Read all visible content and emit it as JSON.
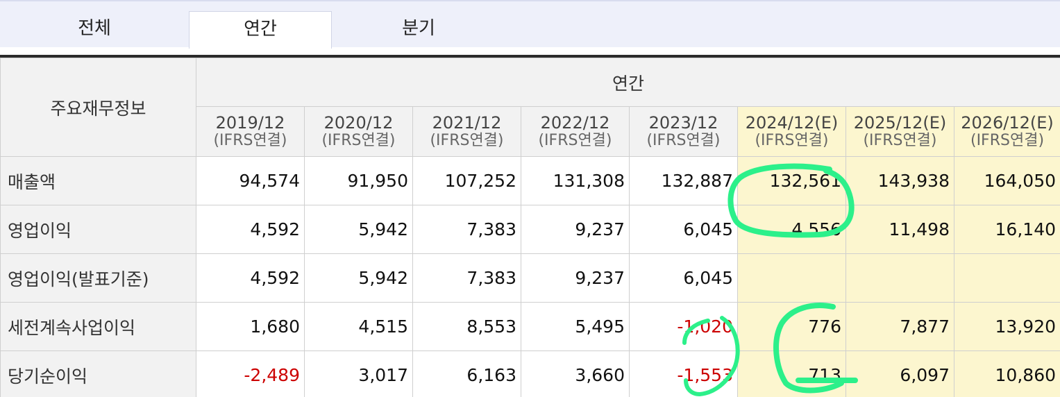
{
  "tabs": [
    {
      "label": "전체"
    },
    {
      "label": "연간"
    },
    {
      "label": "분기"
    }
  ],
  "table": {
    "row_header": "주요재무정보",
    "group_header": "연간",
    "periods": [
      {
        "period": "2019/12",
        "basis": "(IFRS연결)"
      },
      {
        "period": "2020/12",
        "basis": "(IFRS연결)"
      },
      {
        "period": "2021/12",
        "basis": "(IFRS연결)"
      },
      {
        "period": "2022/12",
        "basis": "(IFRS연결)"
      },
      {
        "period": "2023/12",
        "basis": "(IFRS연결)"
      },
      {
        "period": "2024/12(E)",
        "basis": "(IFRS연결)"
      },
      {
        "period": "2025/12(E)",
        "basis": "(IFRS연결)"
      },
      {
        "period": "2026/12(E)",
        "basis": "(IFRS연결)"
      }
    ],
    "rows": [
      {
        "label": "매출액",
        "values": [
          "94,574",
          "91,950",
          "107,252",
          "131,308",
          "132,887",
          "132,561",
          "143,938",
          "164,050"
        ]
      },
      {
        "label": "영업이익",
        "values": [
          "4,592",
          "5,942",
          "7,383",
          "9,237",
          "6,045",
          "4,556",
          "11,498",
          "16,140"
        ]
      },
      {
        "label": "영업이익(발표기준)",
        "values": [
          "4,592",
          "5,942",
          "7,383",
          "9,237",
          "6,045",
          "",
          "",
          ""
        ]
      },
      {
        "label": "세전계속사업이익",
        "values": [
          "1,680",
          "4,515",
          "8,553",
          "5,495",
          "-1,020",
          "776",
          "7,877",
          "13,920"
        ]
      },
      {
        "label": "당기순이익",
        "values": [
          "-2,489",
          "3,017",
          "6,163",
          "3,660",
          "-1,553",
          "713",
          "6,097",
          "10,860"
        ]
      }
    ]
  },
  "colors": {
    "estimate_bg": "#fcf6cf",
    "negative_text": "#cc0000",
    "annotation": "#2cf08a"
  }
}
